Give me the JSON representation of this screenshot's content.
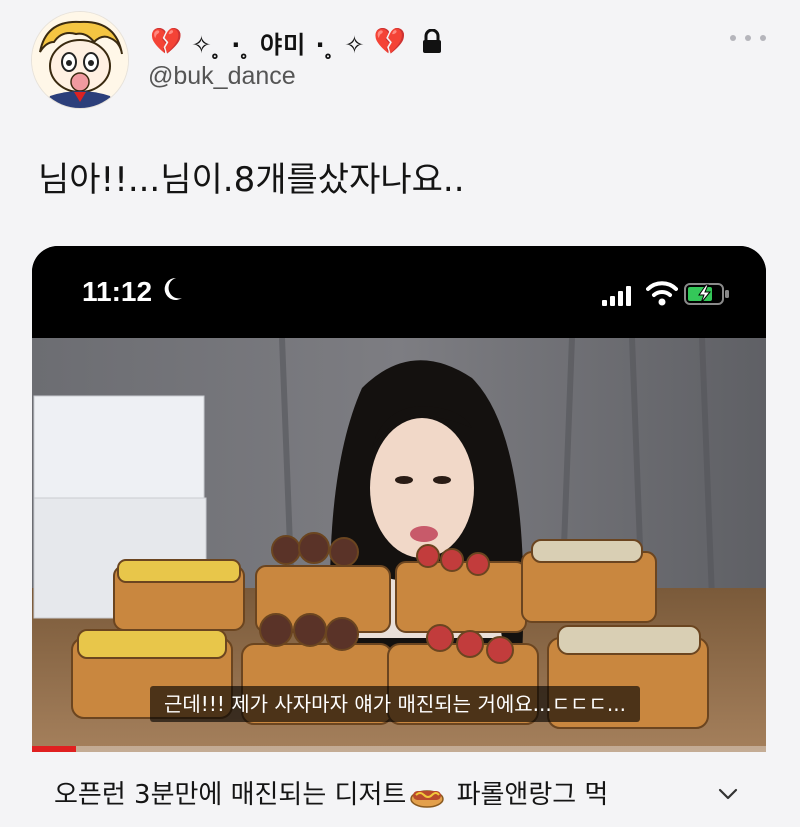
{
  "author": {
    "display_name": "✧ ̥ ·  ̥ 야미 ·  ̥ ✧",
    "heart_left": "💔",
    "heart_right": "💔",
    "handle": "@buk_dance",
    "icons": [
      "avatar",
      "broken-heart-icon",
      "lock-icon",
      "more-icon"
    ]
  },
  "tweet": {
    "text": "님아!!...님이.8개를샀자나요.."
  },
  "media": {
    "status_bar": {
      "time": "11:12",
      "icons": [
        "moon-icon",
        "signal-icon",
        "wifi-icon",
        "battery-icon"
      ]
    },
    "subtitle": "근데!!! 제가 사자마자 얘가 매진되는 거에요...ㄷㄷㄷ...",
    "progress": 0.06
  },
  "caption": {
    "before": "오픈런 3분만에 매진되는 디저트",
    "after": "파롤앤랑그 먹",
    "icons": [
      "hotdog-icon",
      "chevron-down-icon"
    ]
  },
  "colors": {
    "background": "#f4f4f6",
    "heart": "#c22a2a",
    "progress": "#e02020",
    "battery": "#34c759"
  }
}
